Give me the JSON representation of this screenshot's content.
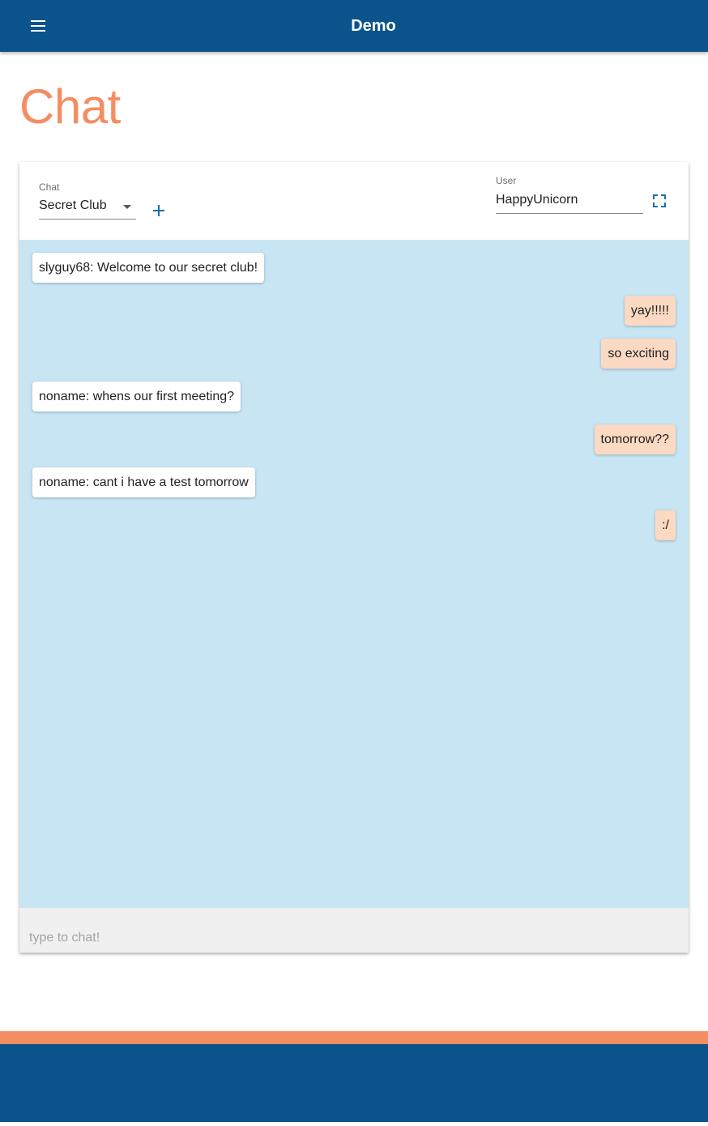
{
  "app_bar": {
    "title": "Demo",
    "menu_icon": "hamburger-menu-icon",
    "color": "#0a548b"
  },
  "page": {
    "title": "Chat",
    "title_color": "#f58d62"
  },
  "chat_card": {
    "chat_select": {
      "label": "Chat",
      "value": "Secret Club"
    },
    "add_icon": "plus-icon",
    "user_field": {
      "label": "User",
      "value": "HappyUnicorn"
    },
    "fullscreen_icon": "fullscreen-icon",
    "messages": [
      {
        "text": "slyguy68: Welcome to our secret club!",
        "mine": false
      },
      {
        "text": "yay!!!!!",
        "mine": true
      },
      {
        "text": "so exciting",
        "mine": true
      },
      {
        "text": "noname: whens our first meeting?",
        "mine": false
      },
      {
        "text": "tomorrow??",
        "mine": true
      },
      {
        "text": "noname: cant i have a test tomorrow",
        "mine": false
      },
      {
        "text": ":/",
        "mine": true
      }
    ],
    "input": {
      "placeholder": "type to chat!",
      "value": ""
    }
  },
  "colors": {
    "messages_background": "#c8e5f4",
    "own_message": "#fbd9c3",
    "other_message": "#ffffff",
    "footer_accent": "#f58d62",
    "footer": "#0a548b"
  }
}
